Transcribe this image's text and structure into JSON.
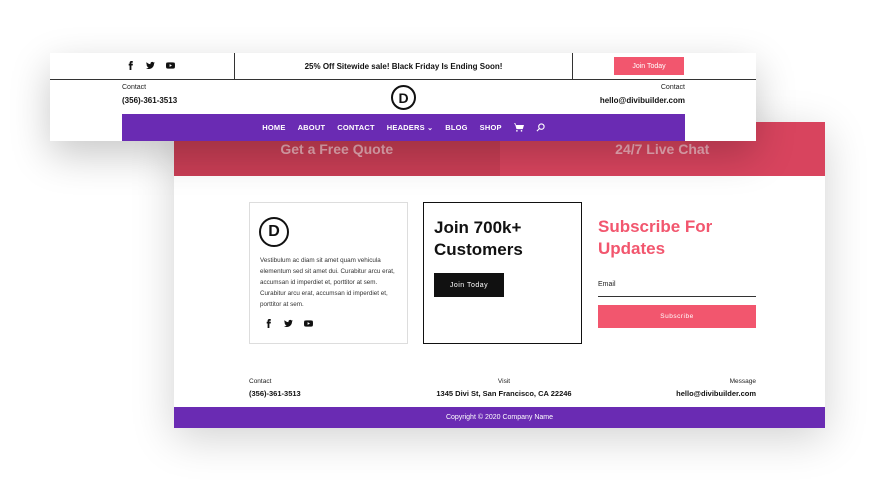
{
  "header": {
    "promo_text": "25% Off Sitewide sale! Black Friday Is Ending Soon!",
    "join_button": "Join Today",
    "contact_left_label": "Contact",
    "contact_left_phone": "(356)-361-3513",
    "contact_right_label": "Contact",
    "contact_right_email": "hello@divibuilder.com",
    "logo_letter": "D",
    "social_icons": [
      "facebook-icon",
      "twitter-icon",
      "youtube-icon"
    ],
    "nav": [
      {
        "label": "HOME"
      },
      {
        "label": "ABOUT"
      },
      {
        "label": "CONTACT"
      },
      {
        "label": "HEADERS",
        "has_dropdown": true
      },
      {
        "label": "BLOG"
      },
      {
        "label": "SHOP"
      }
    ]
  },
  "cta": {
    "left": "Get a Free Quote",
    "right": "24/7 Live Chat"
  },
  "footer": {
    "logo_letter": "D",
    "about_text": "Vestibulum ac diam sit amet quam vehicula elementum sed sit amet dui. Curabitur arcu erat, accumsan id imperdiet et, porttitor at sem. Curabitur arcu erat, accumsan id imperdiet et, porttitor at sem.",
    "join_heading": "Join 700k+ Customers",
    "join_button": "Join Today",
    "subscribe_heading": "Subscribe For Updates",
    "email_label": "Email",
    "subscribe_button": "Subscribe",
    "contact_label": "Contact",
    "contact_phone": "(356)-361-3513",
    "visit_label": "Visit",
    "visit_address": "1345 Divi St, San Francisco, CA 22246",
    "message_label": "Message",
    "message_email": "hello@divibuilder.com",
    "copyright": "Copyright © 2020 Company Name"
  },
  "colors": {
    "purple": "#6a2bb3",
    "pink": "#f2566e",
    "cta_red": "#d8445e"
  }
}
